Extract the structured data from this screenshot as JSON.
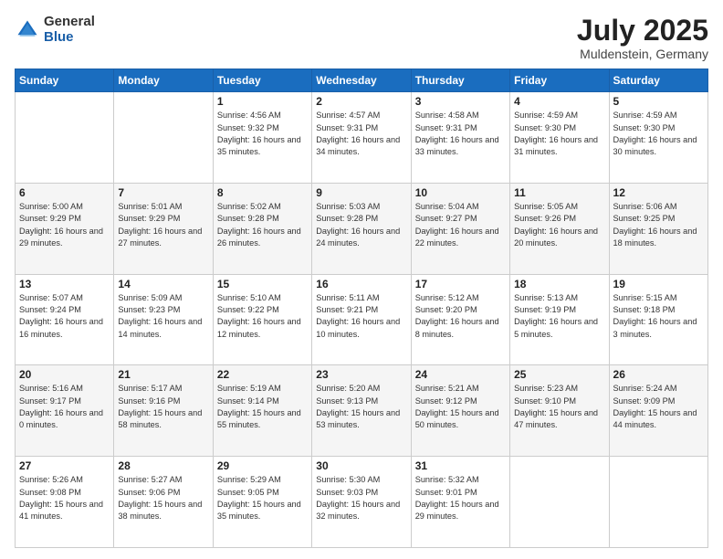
{
  "header": {
    "logo_general": "General",
    "logo_blue": "Blue",
    "month_year": "July 2025",
    "location": "Muldenstein, Germany"
  },
  "weekdays": [
    "Sunday",
    "Monday",
    "Tuesday",
    "Wednesday",
    "Thursday",
    "Friday",
    "Saturday"
  ],
  "weeks": [
    [
      {
        "day": "",
        "info": ""
      },
      {
        "day": "",
        "info": ""
      },
      {
        "day": "1",
        "info": "Sunrise: 4:56 AM\nSunset: 9:32 PM\nDaylight: 16 hours\nand 35 minutes."
      },
      {
        "day": "2",
        "info": "Sunrise: 4:57 AM\nSunset: 9:31 PM\nDaylight: 16 hours\nand 34 minutes."
      },
      {
        "day": "3",
        "info": "Sunrise: 4:58 AM\nSunset: 9:31 PM\nDaylight: 16 hours\nand 33 minutes."
      },
      {
        "day": "4",
        "info": "Sunrise: 4:59 AM\nSunset: 9:30 PM\nDaylight: 16 hours\nand 31 minutes."
      },
      {
        "day": "5",
        "info": "Sunrise: 4:59 AM\nSunset: 9:30 PM\nDaylight: 16 hours\nand 30 minutes."
      }
    ],
    [
      {
        "day": "6",
        "info": "Sunrise: 5:00 AM\nSunset: 9:29 PM\nDaylight: 16 hours\nand 29 minutes."
      },
      {
        "day": "7",
        "info": "Sunrise: 5:01 AM\nSunset: 9:29 PM\nDaylight: 16 hours\nand 27 minutes."
      },
      {
        "day": "8",
        "info": "Sunrise: 5:02 AM\nSunset: 9:28 PM\nDaylight: 16 hours\nand 26 minutes."
      },
      {
        "day": "9",
        "info": "Sunrise: 5:03 AM\nSunset: 9:28 PM\nDaylight: 16 hours\nand 24 minutes."
      },
      {
        "day": "10",
        "info": "Sunrise: 5:04 AM\nSunset: 9:27 PM\nDaylight: 16 hours\nand 22 minutes."
      },
      {
        "day": "11",
        "info": "Sunrise: 5:05 AM\nSunset: 9:26 PM\nDaylight: 16 hours\nand 20 minutes."
      },
      {
        "day": "12",
        "info": "Sunrise: 5:06 AM\nSunset: 9:25 PM\nDaylight: 16 hours\nand 18 minutes."
      }
    ],
    [
      {
        "day": "13",
        "info": "Sunrise: 5:07 AM\nSunset: 9:24 PM\nDaylight: 16 hours\nand 16 minutes."
      },
      {
        "day": "14",
        "info": "Sunrise: 5:09 AM\nSunset: 9:23 PM\nDaylight: 16 hours\nand 14 minutes."
      },
      {
        "day": "15",
        "info": "Sunrise: 5:10 AM\nSunset: 9:22 PM\nDaylight: 16 hours\nand 12 minutes."
      },
      {
        "day": "16",
        "info": "Sunrise: 5:11 AM\nSunset: 9:21 PM\nDaylight: 16 hours\nand 10 minutes."
      },
      {
        "day": "17",
        "info": "Sunrise: 5:12 AM\nSunset: 9:20 PM\nDaylight: 16 hours\nand 8 minutes."
      },
      {
        "day": "18",
        "info": "Sunrise: 5:13 AM\nSunset: 9:19 PM\nDaylight: 16 hours\nand 5 minutes."
      },
      {
        "day": "19",
        "info": "Sunrise: 5:15 AM\nSunset: 9:18 PM\nDaylight: 16 hours\nand 3 minutes."
      }
    ],
    [
      {
        "day": "20",
        "info": "Sunrise: 5:16 AM\nSunset: 9:17 PM\nDaylight: 16 hours\nand 0 minutes."
      },
      {
        "day": "21",
        "info": "Sunrise: 5:17 AM\nSunset: 9:16 PM\nDaylight: 15 hours\nand 58 minutes."
      },
      {
        "day": "22",
        "info": "Sunrise: 5:19 AM\nSunset: 9:14 PM\nDaylight: 15 hours\nand 55 minutes."
      },
      {
        "day": "23",
        "info": "Sunrise: 5:20 AM\nSunset: 9:13 PM\nDaylight: 15 hours\nand 53 minutes."
      },
      {
        "day": "24",
        "info": "Sunrise: 5:21 AM\nSunset: 9:12 PM\nDaylight: 15 hours\nand 50 minutes."
      },
      {
        "day": "25",
        "info": "Sunrise: 5:23 AM\nSunset: 9:10 PM\nDaylight: 15 hours\nand 47 minutes."
      },
      {
        "day": "26",
        "info": "Sunrise: 5:24 AM\nSunset: 9:09 PM\nDaylight: 15 hours\nand 44 minutes."
      }
    ],
    [
      {
        "day": "27",
        "info": "Sunrise: 5:26 AM\nSunset: 9:08 PM\nDaylight: 15 hours\nand 41 minutes."
      },
      {
        "day": "28",
        "info": "Sunrise: 5:27 AM\nSunset: 9:06 PM\nDaylight: 15 hours\nand 38 minutes."
      },
      {
        "day": "29",
        "info": "Sunrise: 5:29 AM\nSunset: 9:05 PM\nDaylight: 15 hours\nand 35 minutes."
      },
      {
        "day": "30",
        "info": "Sunrise: 5:30 AM\nSunset: 9:03 PM\nDaylight: 15 hours\nand 32 minutes."
      },
      {
        "day": "31",
        "info": "Sunrise: 5:32 AM\nSunset: 9:01 PM\nDaylight: 15 hours\nand 29 minutes."
      },
      {
        "day": "",
        "info": ""
      },
      {
        "day": "",
        "info": ""
      }
    ]
  ]
}
